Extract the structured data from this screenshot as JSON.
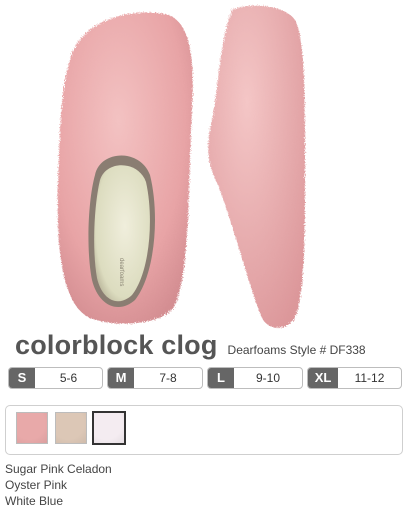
{
  "product": {
    "title": "colorblock clog",
    "style_number": "Dearfoams Style # DF338",
    "image_name": "pink-fuzzy-slipper-clog",
    "accent_color": "#e9a8a8"
  },
  "sizes": [
    {
      "code": "S",
      "range": "5-6"
    },
    {
      "code": "M",
      "range": "7-8"
    },
    {
      "code": "L",
      "range": "9-10"
    },
    {
      "code": "XL",
      "range": "11-12"
    }
  ],
  "swatches": [
    {
      "color": "#e8a9a9",
      "selected": false
    },
    {
      "color": "#dcc7b6",
      "selected": false
    },
    {
      "color": "#f4ecf1",
      "selected": true
    }
  ],
  "color_names": [
    "Sugar Pink Celadon",
    "Oyster Pink",
    "White Blue"
  ]
}
